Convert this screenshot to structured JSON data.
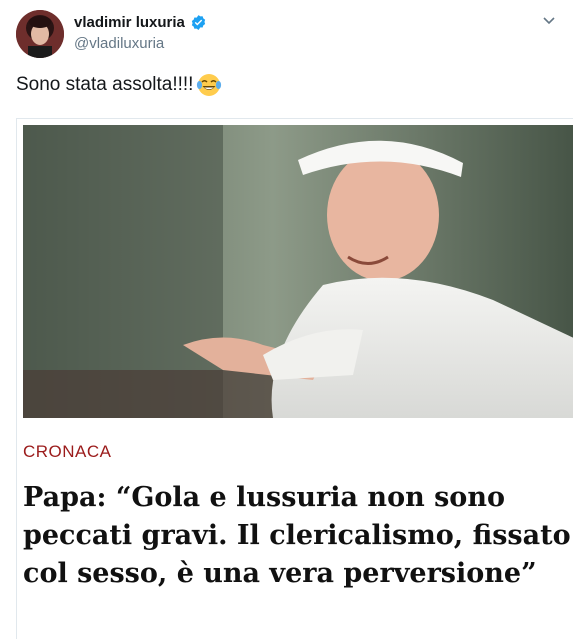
{
  "user": {
    "display_name": "vladimir luxuria",
    "handle": "@vladiluxuria",
    "verified": true,
    "avatar_icon": "profile-photo"
  },
  "tweet": {
    "text": "Sono stata assolta!!!!",
    "emoji": "face-with-tears-of-joy"
  },
  "card": {
    "image": "pope-francis-photo",
    "section": "CRONACA",
    "headline_lines": [
      "Papa: “Gola e lussuria non sono",
      "peccati gravi. Il clericalismo, fissato",
      "col sesso, è una vera perversione”"
    ]
  },
  "colors": {
    "verified_blue": "#1da1f2",
    "section_red": "#9b1b1b",
    "handle_gray": "#657786"
  }
}
